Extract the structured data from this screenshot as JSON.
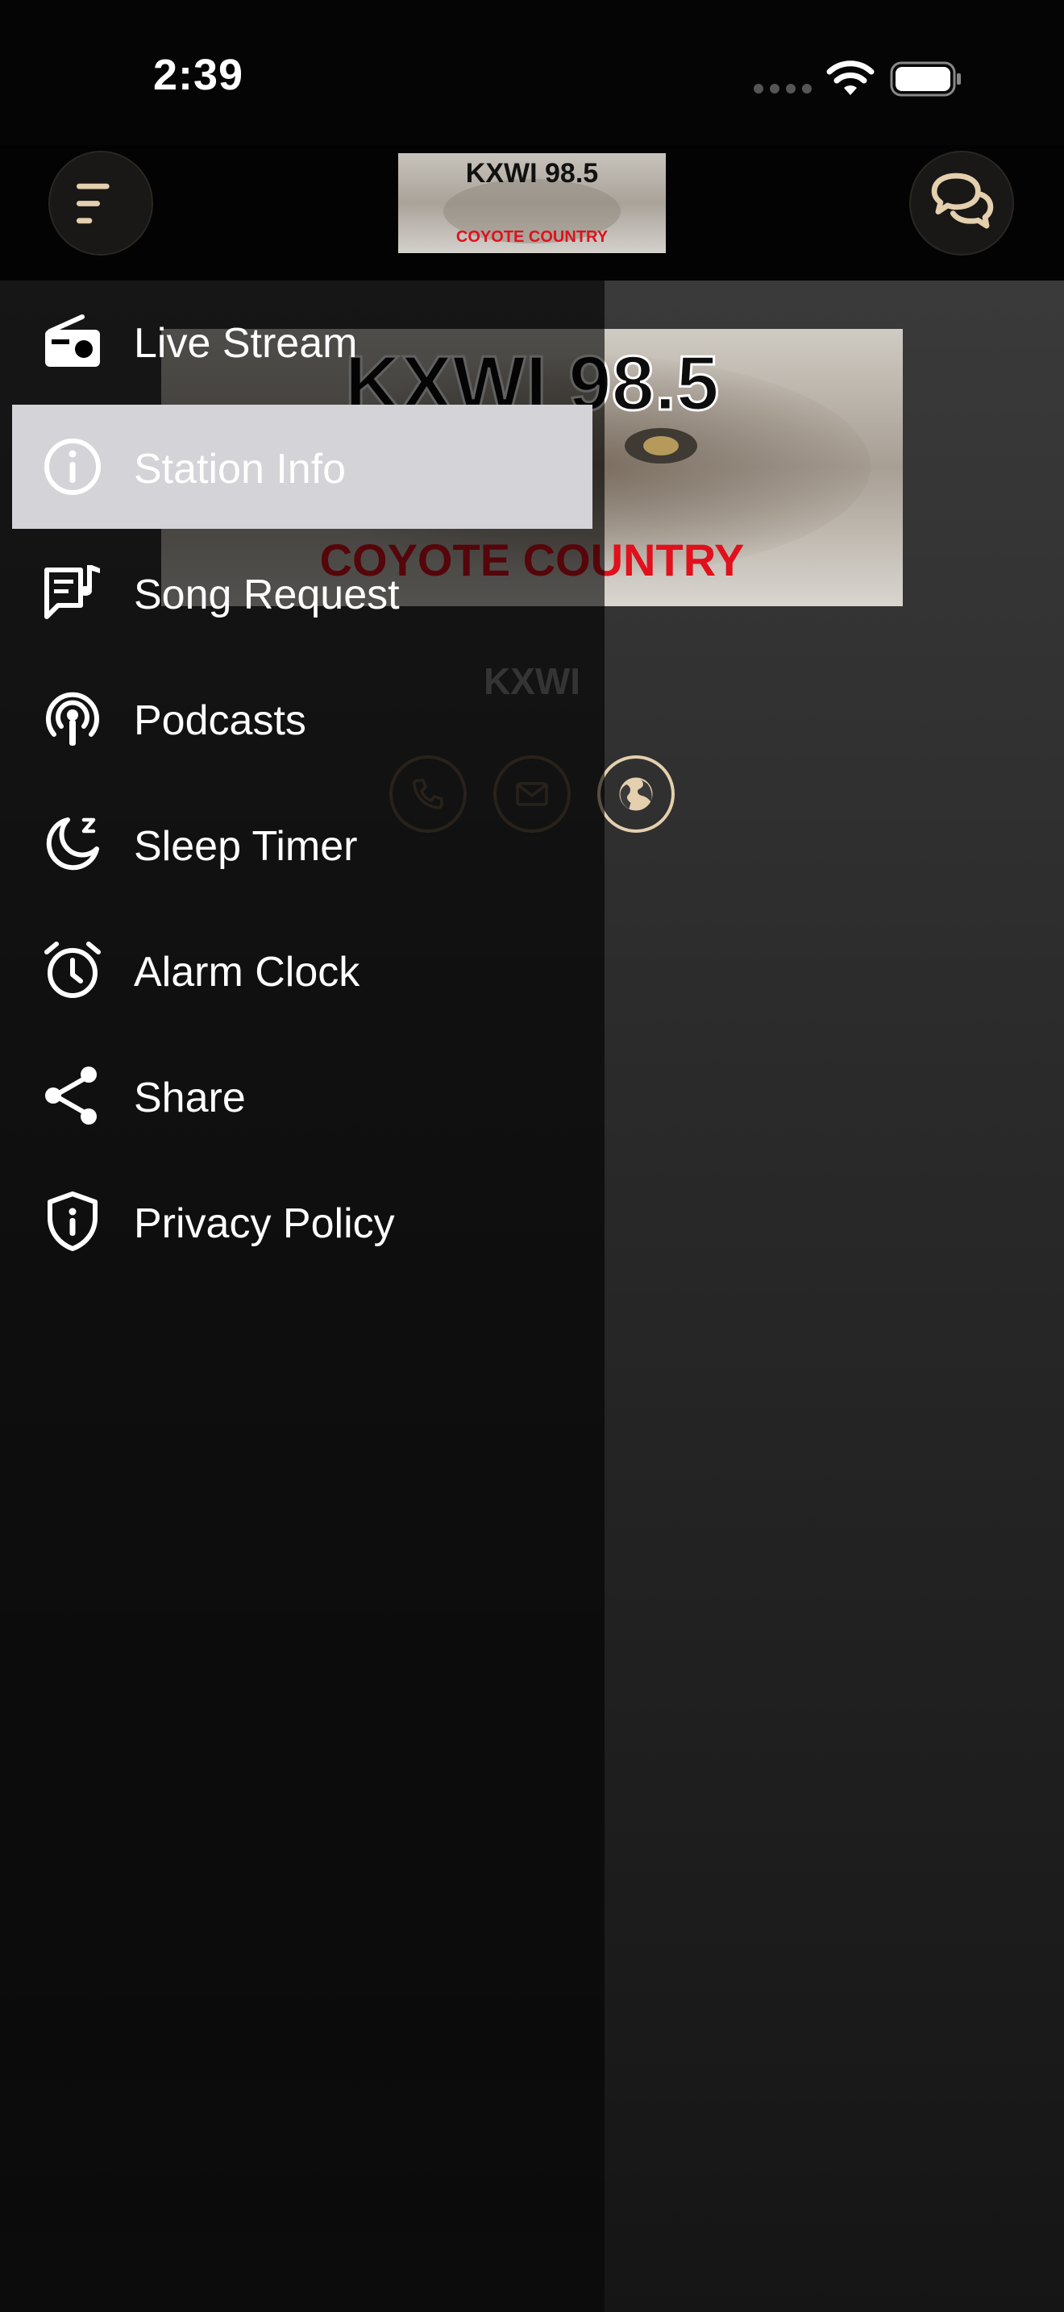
{
  "status_bar": {
    "time": "2:39"
  },
  "header": {
    "logo": {
      "line1": "KXWI 98.5",
      "line2": "COYOTE COUNTRY"
    },
    "menu_icon": "menu-icon",
    "chat_icon": "chat-icon"
  },
  "main": {
    "logo": {
      "line1": "KXWI 98.5",
      "line2": "COYOTE COUNTRY"
    },
    "station_name": "KXWI",
    "contacts": [
      {
        "icon": "phone-icon"
      },
      {
        "icon": "mail-icon"
      },
      {
        "icon": "globe-icon"
      }
    ]
  },
  "drawer": {
    "items": [
      {
        "label": "Live Stream",
        "icon": "radio-icon"
      },
      {
        "label": "Station Info",
        "icon": "info-icon",
        "selected": true
      },
      {
        "label": "Song Request",
        "icon": "song-request-icon"
      },
      {
        "label": "Podcasts",
        "icon": "podcast-icon"
      },
      {
        "label": "Sleep Timer",
        "icon": "sleep-timer-icon"
      },
      {
        "label": "Alarm Clock",
        "icon": "alarm-clock-icon"
      },
      {
        "label": "Share",
        "icon": "share-icon"
      },
      {
        "label": "Privacy Policy",
        "icon": "shield-icon"
      }
    ]
  },
  "colors": {
    "accent": "#e4cfae",
    "selected_bg": "#d3d3d8",
    "logo_red": "#e0101c"
  }
}
